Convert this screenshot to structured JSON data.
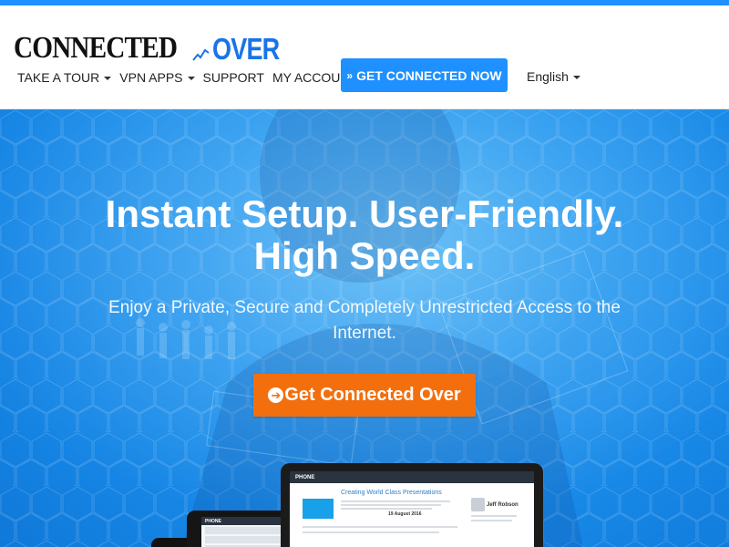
{
  "brand": {
    "logo_left": "CONNECTED",
    "logo_right": "OVER",
    "logo_color": "#1a73e8"
  },
  "nav": {
    "items": [
      {
        "label": "TAKE A TOUR",
        "dropdown": true
      },
      {
        "label": "VPN APPS",
        "dropdown": true
      },
      {
        "label": "SUPPORT",
        "dropdown": false
      },
      {
        "label": "MY ACCOUNT",
        "dropdown": false
      }
    ],
    "cta_label": "GET CONNECTED NOW",
    "cta_icon": "double-chevron-right-icon",
    "language": "English"
  },
  "hero": {
    "title_line1": "Instant Setup. User-Friendly.",
    "title_line2": "High Speed.",
    "subtitle": "Enjoy a Private, Secure and Completely Unrestricted Access to the Internet.",
    "cta_label": "Get Connected Over",
    "cta_icon": "arrow-circle-right-icon",
    "cta_color": "#f36f0e",
    "background_color": "#2d9cf0"
  },
  "mockup": {
    "tablet_heading": "Creating World Class Presentations",
    "tablet_contact": "Jeff Robson",
    "tablet_date": "19 August 2016"
  },
  "colors": {
    "accent": "#1e90ff",
    "orange": "#f36f0e"
  }
}
